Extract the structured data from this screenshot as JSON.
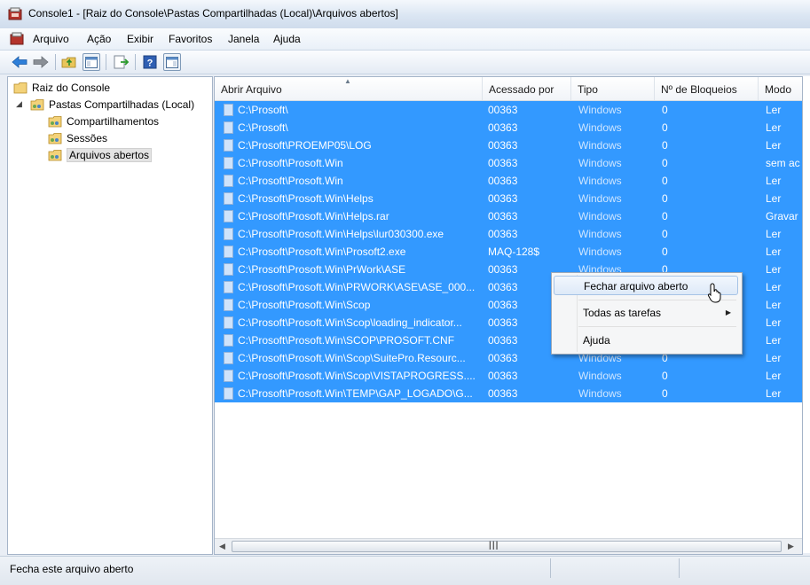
{
  "window": {
    "title": "Console1 - [Raiz do Console\\Pastas Compartilhadas (Local)\\Arquivos abertos]"
  },
  "menubar": {
    "items": [
      "Arquivo",
      "Ação",
      "Exibir",
      "Favoritos",
      "Janela",
      "Ajuda"
    ]
  },
  "toolbar": {
    "icons": [
      "back-arrow-icon",
      "forward-arrow-icon",
      "up-folder-icon",
      "show-hide-tree-icon",
      "export-list-icon",
      "help-icon",
      "show-hide-action-pane-icon"
    ]
  },
  "tree": {
    "root": "Raiz do Console",
    "shared": "Pastas Compartilhadas (Local)",
    "children": [
      "Compartilhamentos",
      "Sessões",
      "Arquivos abertos"
    ],
    "selected": "Arquivos abertos"
  },
  "list": {
    "columns": [
      "Abrir Arquivo",
      "Acessado por",
      "Tipo",
      "Nº de Bloqueios",
      "Modo"
    ],
    "rows": [
      {
        "file": "C:\\Prosoft\\",
        "user": "00363",
        "type": "Windows",
        "locks": "0",
        "mode": "Ler"
      },
      {
        "file": "C:\\Prosoft\\",
        "user": "00363",
        "type": "Windows",
        "locks": "0",
        "mode": "Ler"
      },
      {
        "file": "C:\\Prosoft\\PROEMP05\\LOG",
        "user": "00363",
        "type": "Windows",
        "locks": "0",
        "mode": "Ler"
      },
      {
        "file": "C:\\Prosoft\\Prosoft.Win",
        "user": "00363",
        "type": "Windows",
        "locks": "0",
        "mode": "sem ac"
      },
      {
        "file": "C:\\Prosoft\\Prosoft.Win",
        "user": "00363",
        "type": "Windows",
        "locks": "0",
        "mode": "Ler"
      },
      {
        "file": "C:\\Prosoft\\Prosoft.Win\\Helps",
        "user": "00363",
        "type": "Windows",
        "locks": "0",
        "mode": "Ler"
      },
      {
        "file": "C:\\Prosoft\\Prosoft.Win\\Helps.rar",
        "user": "00363",
        "type": "Windows",
        "locks": "0",
        "mode": "Gravar"
      },
      {
        "file": "C:\\Prosoft\\Prosoft.Win\\Helps\\lur030300.exe",
        "user": "00363",
        "type": "Windows",
        "locks": "0",
        "mode": "Ler"
      },
      {
        "file": "C:\\Prosoft\\Prosoft.Win\\Prosoft2.exe",
        "user": "MAQ-128$",
        "type": "Windows",
        "locks": "0",
        "mode": "Ler"
      },
      {
        "file": "C:\\Prosoft\\Prosoft.Win\\PrWork\\ASE",
        "user": "00363",
        "type": "Windows",
        "locks": "0",
        "mode": "Ler"
      },
      {
        "file": "C:\\Prosoft\\Prosoft.Win\\PRWORK\\ASE\\ASE_000...",
        "user": "00363",
        "type": "Windows",
        "locks": "0",
        "mode": "Ler"
      },
      {
        "file": "C:\\Prosoft\\Prosoft.Win\\Scop",
        "user": "00363",
        "type": "Windows",
        "locks": "0",
        "mode": "Ler"
      },
      {
        "file": "C:\\Prosoft\\Prosoft.Win\\Scop\\loading_indicator...",
        "user": "00363",
        "type": "Windows",
        "locks": "0",
        "mode": "Ler"
      },
      {
        "file": "C:\\Prosoft\\Prosoft.Win\\SCOP\\PROSOFT.CNF",
        "user": "00363",
        "type": "Windows",
        "locks": "0",
        "mode": "Ler"
      },
      {
        "file": "C:\\Prosoft\\Prosoft.Win\\Scop\\SuitePro.Resourc...",
        "user": "00363",
        "type": "Windows",
        "locks": "0",
        "mode": "Ler"
      },
      {
        "file": "C:\\Prosoft\\Prosoft.Win\\Scop\\VISTAPROGRESS....",
        "user": "00363",
        "type": "Windows",
        "locks": "0",
        "mode": "Ler"
      },
      {
        "file": "C:\\Prosoft\\Prosoft.Win\\TEMP\\GAP_LOGADO\\G...",
        "user": "00363",
        "type": "Windows",
        "locks": "0",
        "mode": "Ler"
      }
    ]
  },
  "context_menu": {
    "items": [
      "Fechar arquivo aberto",
      "Todas as tarefas",
      "Ajuda"
    ]
  },
  "statusbar": {
    "text": "Fecha este arquivo aberto"
  },
  "colors": {
    "selection": "#3399ff",
    "window_bg": "#e9eef5"
  }
}
